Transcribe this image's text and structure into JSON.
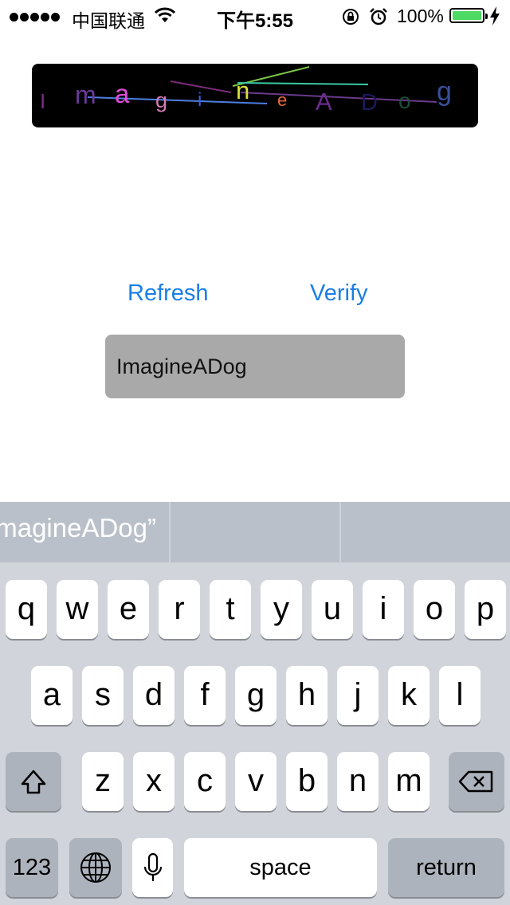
{
  "status_bar": {
    "carrier": "中国联通",
    "time": "下午5:55",
    "battery": "100%",
    "battery_level": 1.0
  },
  "captcha": {
    "chars": [
      {
        "ch": "I",
        "color": "#7a2b88"
      },
      {
        "ch": "m",
        "color": "#6a3a9a"
      },
      {
        "ch": "a",
        "color": "#e04cd8"
      },
      {
        "ch": "g",
        "color": "#d77bb8"
      },
      {
        "ch": "i",
        "color": "#3b5ee0"
      },
      {
        "ch": "n",
        "color": "#d9e23a"
      },
      {
        "ch": "e",
        "color": "#e8683a"
      },
      {
        "ch": "A",
        "color": "#6b2c8c"
      },
      {
        "ch": "D",
        "color": "#1a1a5e"
      },
      {
        "ch": "o",
        "color": "#1f4d3a"
      },
      {
        "ch": "g",
        "color": "#3a4f9a"
      }
    ]
  },
  "actions": {
    "refresh_label": "Refresh",
    "verify_label": "Verify"
  },
  "answer_field": {
    "value": "ImagineADog"
  },
  "keyboard": {
    "prediction": "“ImagineADog”",
    "rows": [
      [
        "q",
        "w",
        "e",
        "r",
        "t",
        "y",
        "u",
        "i",
        "o",
        "p"
      ],
      [
        "a",
        "s",
        "d",
        "f",
        "g",
        "h",
        "j",
        "k",
        "l"
      ],
      [
        "z",
        "x",
        "c",
        "v",
        "b",
        "n",
        "m"
      ]
    ],
    "numbers_label": "123",
    "space_label": "space",
    "return_label": "return",
    "icons": [
      "shift-icon",
      "backspace-icon",
      "globe-icon",
      "microphone-icon"
    ]
  },
  "colors": {
    "link_blue": "#1a7ee8",
    "keyboard_bg": "#d1d5db",
    "field_bg": "#a9a9a9",
    "battery_green": "#4cd964"
  }
}
